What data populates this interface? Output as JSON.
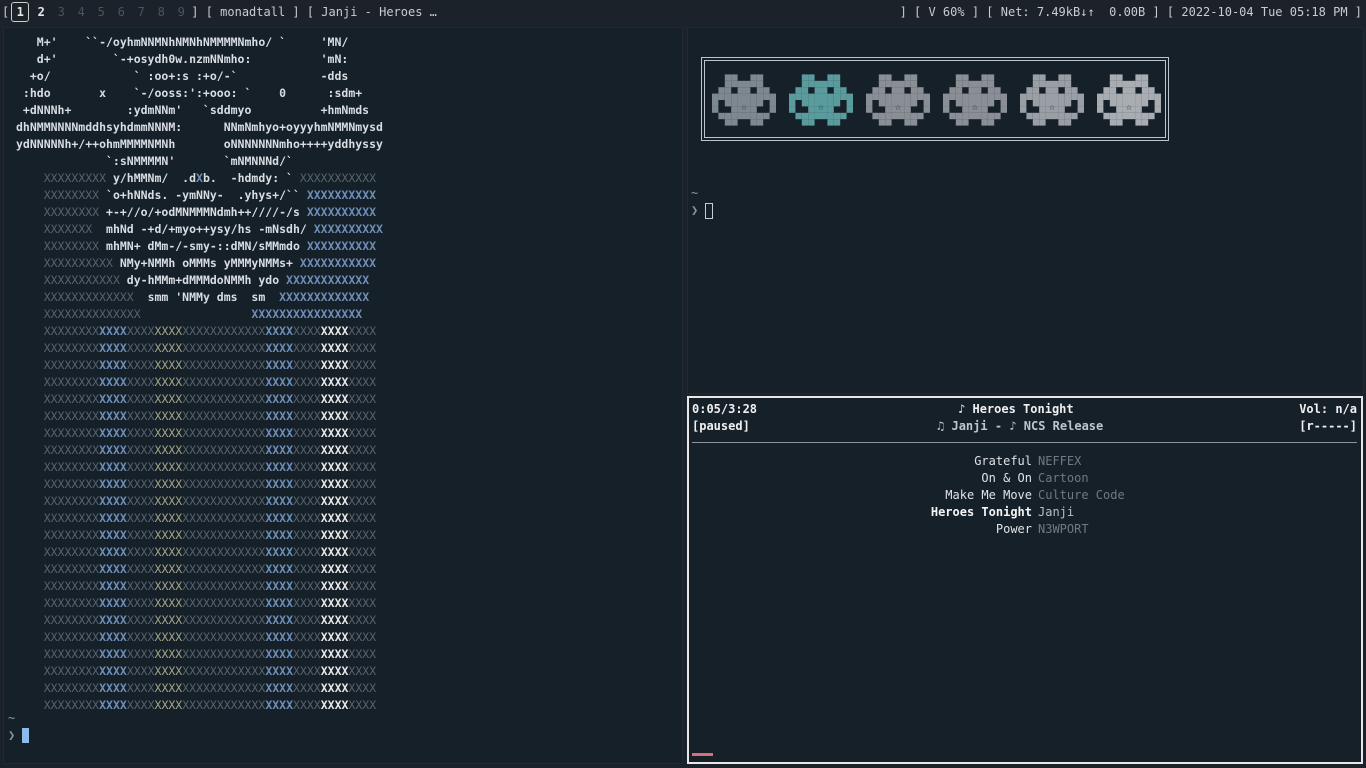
{
  "bar": {
    "workspaces": [
      {
        "label": "1",
        "state": "active"
      },
      {
        "label": "2",
        "state": "occupied"
      },
      {
        "label": "3",
        "state": "empty"
      },
      {
        "label": "4",
        "state": "empty"
      },
      {
        "label": "5",
        "state": "empty"
      },
      {
        "label": "6",
        "state": "empty"
      },
      {
        "label": "7",
        "state": "empty"
      },
      {
        "label": "8",
        "state": "empty"
      },
      {
        "label": "9",
        "state": "empty"
      }
    ],
    "open_bracket": "[",
    "close_bracket": "]",
    "layout": "[ monadtall ]",
    "window_title": "[ Janji - Heroes …",
    "right_sep": "]",
    "volume": "[ V 60% ]",
    "net": "[ Net: 7.49kB↓↑  0.00B ]",
    "datetime": "[ 2022-10-04 Tue 05:18 PM ]"
  },
  "left_terminal": {
    "ascii_lines": [
      "   M+'    ``-/oyhmNNMNhNMNhNMMMMNmho/ `     'MN/",
      "   d+'        `-+osydh0w.nzmNNmho:          'mN:",
      "  +o/            ` :oo+:s :+o/-`            -dds",
      " :hdo       x    `-/ooss:':+ooo: `    0      :sdm+",
      " +dNNNh+        :ydmNNm'   `sddmyo          +hmNmds",
      "dhNMMNNNNmddhsyhdmmNNNM:      NNmNmhyo+oyyyhmNMMNmysd",
      "ydNNNNNh+/++ohmMMMMNMNh       oNNNNNNNmho++++yddhyssy",
      "             `:sNMMMMN'       `mNMNNNd/`"
    ],
    "ascii_block_lines": [
      "    XXXXXXXXX y/hMMNm/  .dXb.  -hdmdy: ` XXXXXXXXXXX",
      "    XXXXXXXX `o+hNNds. -ymNNy-  .yhys+/`` XXXXXXXXXX",
      "    XXXXXXXX +-+//o/+odMNMMMNdmh++////-/s XXXXXXXXXX",
      "    XXXXXXX  mhNd -+d/+myo++ysy/hs -mNsdh/ XXXXXXXXXX",
      "    XXXXXXXX mhMN+ dMm-/-smy-::dMN/sMMmdo XXXXXXXXXX",
      "    XXXXXXXXXX NMy+NMMh oMMMs yMMMyNMMs+ XXXXXXXXXXX",
      "    XXXXXXXXXXX dy-hMMm+dMMMdoNMMh ydo XXXXXXXXXXXX",
      "    XXXXXXXXXXXXX  smm 'NMMy dms  sm  XXXXXXXXXXXXX",
      "    XXXXXXXXXXXXXX                XXXXXXXXXXXXXXXX"
    ],
    "grid_row": "XXXXXXXXXXXXXXXXXXXXXXXXXXXXXXXXXXXXXXXXXXXXXXXX",
    "grid_row_count": 23,
    "prompt_tilde": "~",
    "prompt_chevron": "❯"
  },
  "top_right_terminal": {
    "invader_count": 6,
    "invader_colors": [
      "#7d8891",
      "#5a9c9e",
      "#8a8f95",
      "#8a8f95",
      "#9a9fa5",
      "#a8adb2"
    ],
    "prompt_tilde": "~",
    "prompt_chevron": "❯"
  },
  "music_player": {
    "elapsed": "0:05/3:28",
    "status": "[paused]",
    "title_icon": "♪",
    "title": "Heroes Tonight",
    "artist_icon": "♫",
    "artist": "Janji",
    "dash": "-",
    "album_icon": "♪",
    "album": "NCS Release",
    "volume": "Vol: n/a",
    "flags": "[r-----]",
    "progress": 0.024,
    "playlist": [
      {
        "title": "Grateful",
        "artist": "NEFFEX",
        "current": false
      },
      {
        "title": "On & On",
        "artist": "Cartoon",
        "current": false
      },
      {
        "title": "Make Me Move",
        "artist": "Culture Code",
        "current": false
      },
      {
        "title": "Heroes Tonight",
        "artist": "Janji",
        "current": true
      },
      {
        "title": "Power",
        "artist": "N3WPORT",
        "current": false
      }
    ]
  }
}
